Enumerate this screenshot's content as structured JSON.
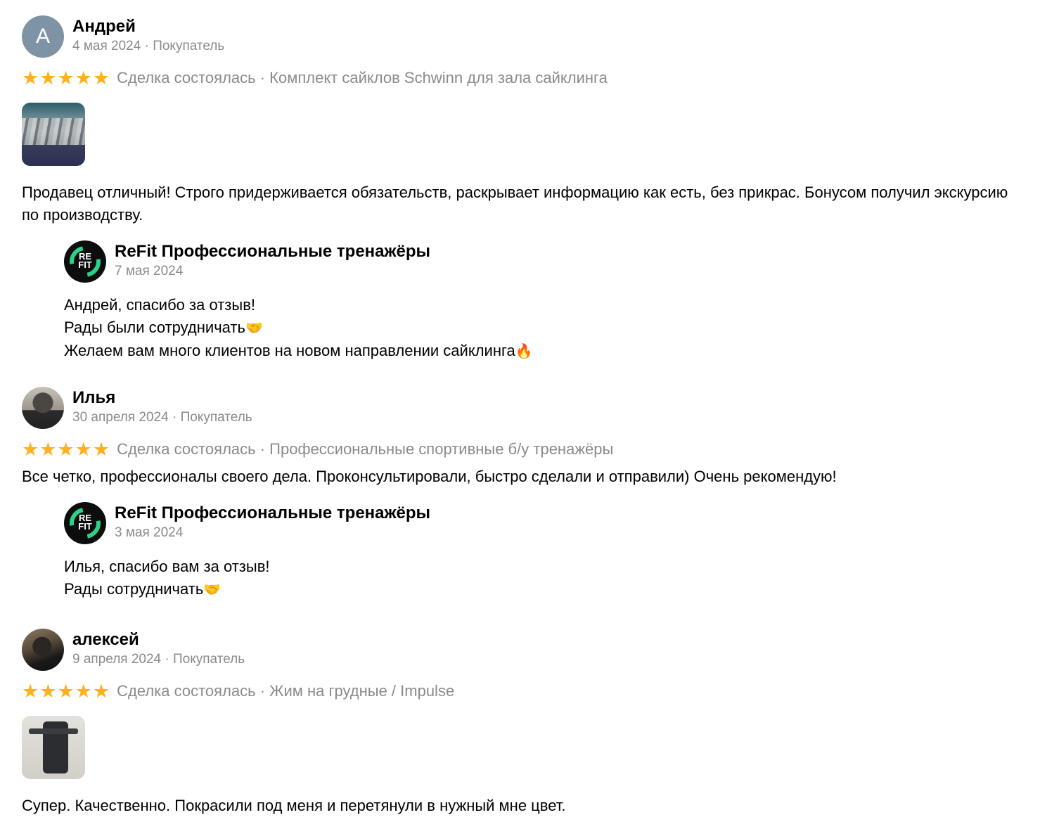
{
  "reviews": [
    {
      "avatar_letter": "А",
      "name": "Андрей",
      "meta": "4 мая 2024 · Покупатель",
      "stars": 5,
      "deal": "Сделка состоялась · Комплект сайклов Schwinn для зала сайклинга",
      "text": "Продавец отличный! Строго придерживается обязательств, раскрывает информацию как есть, без прикрас. Бонусом получил экскурсию по производству.",
      "reply": {
        "name": "ReFit Профессиональные тренажёры",
        "date": "7 мая 2024",
        "lines": [
          "Андрей, спасибо за отзыв!",
          "Рады были сотрудничать",
          "Желаем вам много клиентов на новом направлении сайклинга"
        ],
        "emojis": [
          "",
          "🤝",
          "🔥"
        ]
      }
    },
    {
      "name": "Илья",
      "meta": "30 апреля 2024 · Покупатель",
      "stars": 5,
      "deal": "Сделка состоялась · Профессиональные спортивные б/у тренажёры",
      "text": "Все четко, профессионалы своего дела. Проконсультировали, быстро сделали и отправили) Очень рекомендую!",
      "reply": {
        "name": "ReFit Профессиональные тренажёры",
        "date": "3 мая 2024",
        "lines": [
          "Илья, спасибо вам за отзыв!",
          "Рады сотрудничать"
        ],
        "emojis": [
          "",
          "🤝"
        ]
      }
    },
    {
      "name": "алексей",
      "meta": "9 апреля 2024 · Покупатель",
      "stars": 5,
      "deal": "Сделка состоялась · Жим на грудные / Impulse",
      "text": "Супер. Качественно. Покрасили под меня и перетянули в нужный мне цвет."
    }
  ],
  "logo_text": [
    "RE",
    "FIT"
  ],
  "star_char": "★",
  "colors": {
    "star": "#ffb021",
    "muted": "#8a8a8a",
    "logo_accent": "#2bd08a"
  }
}
